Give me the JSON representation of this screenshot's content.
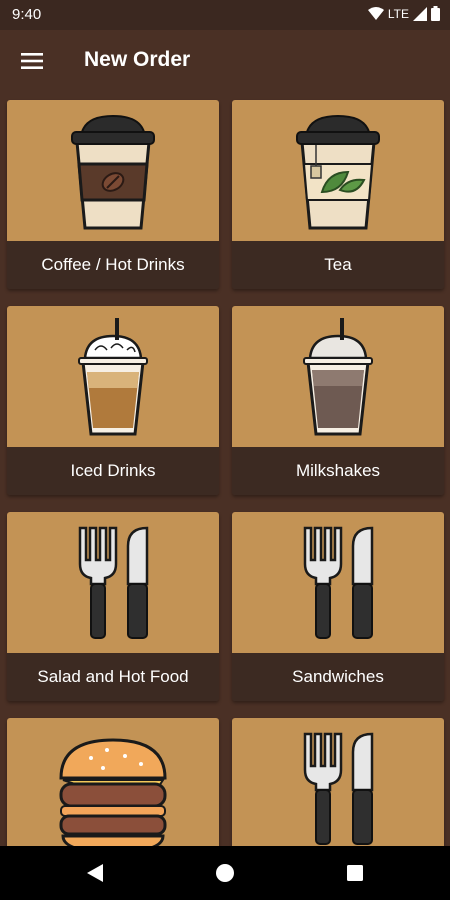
{
  "status_bar": {
    "time": "9:40",
    "network": "LTE"
  },
  "app_bar": {
    "title": "New Order",
    "menu_icon": "hamburger-menu-icon"
  },
  "categories": [
    {
      "label": "Coffee / Hot Drinks",
      "icon": "coffee-cup-icon"
    },
    {
      "label": "Tea",
      "icon": "tea-cup-icon"
    },
    {
      "label": "Iced Drinks",
      "icon": "iced-drink-icon"
    },
    {
      "label": "Milkshakes",
      "icon": "milkshake-icon"
    },
    {
      "label": "Salad and Hot Food",
      "icon": "fork-knife-icon"
    },
    {
      "label": "Sandwiches",
      "icon": "fork-knife-icon"
    },
    {
      "label": "",
      "icon": "burger-icon"
    },
    {
      "label": "",
      "icon": "fork-knife-icon"
    }
  ],
  "nav_bar": {
    "back": "back-icon",
    "home": "home-icon",
    "recents": "recents-icon"
  },
  "colors": {
    "background": "#4a3025",
    "card_image": "#c39355",
    "card_label": "#3c2a22"
  }
}
